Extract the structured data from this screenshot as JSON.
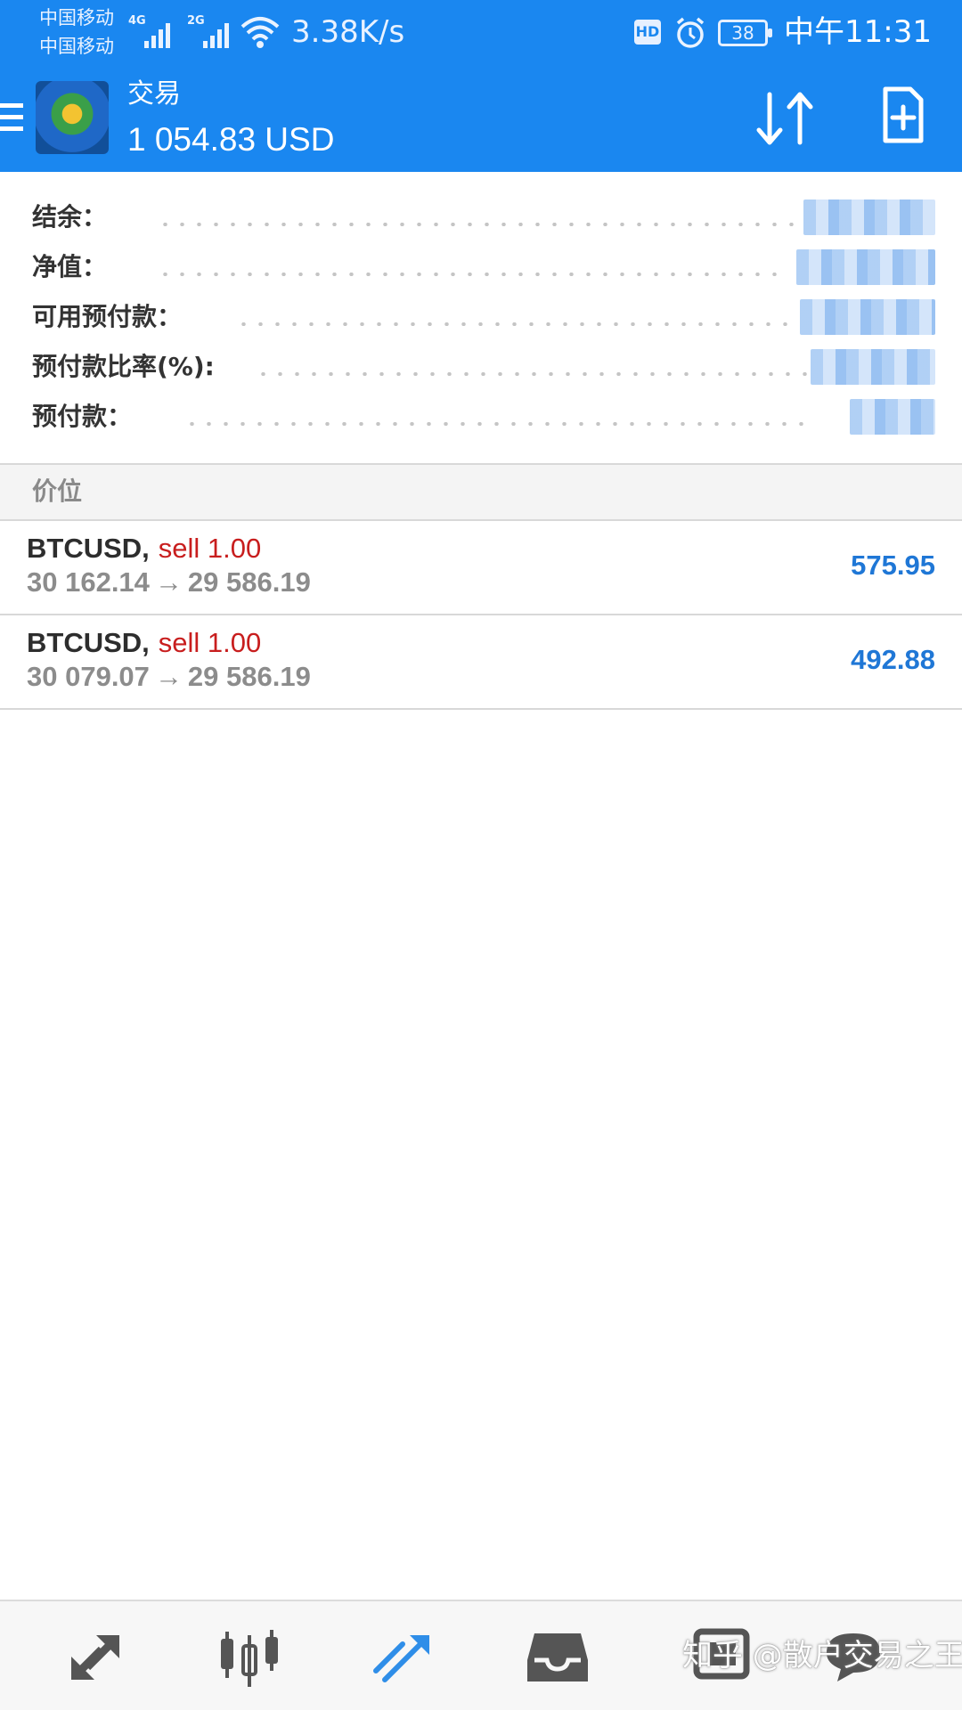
{
  "status_bar": {
    "carrier_1": "中国移动",
    "carrier_2": "中国移动",
    "network_1": "4G",
    "network_2": "2G",
    "net_speed": "3.38K/s",
    "hd_badge": "HD",
    "battery_level": "38",
    "time": "中午11:31"
  },
  "app_bar": {
    "title": "交易",
    "balance": "1 054.83 USD",
    "icons": {
      "menu": "menu-icon",
      "sort": "sort-icon",
      "new_order": "new-order-icon"
    }
  },
  "summary": {
    "rows": [
      {
        "label": "结余："
      },
      {
        "label": "净值："
      },
      {
        "label": "可用预付款："
      },
      {
        "label": "预付款比率(%):"
      },
      {
        "label": "预付款："
      }
    ]
  },
  "section": {
    "title": "价位"
  },
  "positions": [
    {
      "symbol": "BTCUSD",
      "side": "sell 1.00",
      "open_price": "30 162.14",
      "current_price": "29 586.19",
      "profit": "575.95"
    },
    {
      "symbol": "BTCUSD",
      "side": "sell 1.00",
      "open_price": "30 079.07",
      "current_price": "29 586.19",
      "profit": "492.88"
    }
  ],
  "bottom_nav": {
    "items": [
      "quotes-icon",
      "chart-icon",
      "trade-icon",
      "history-icon",
      "messages-icon",
      "chat-icon"
    ],
    "watermark": "知乎 @散户交易之王"
  },
  "colors": {
    "header_bg": "#1a87f0",
    "sell": "#c81e1e",
    "profit": "#1f77d6",
    "active_nav": "#2f8ee8"
  }
}
